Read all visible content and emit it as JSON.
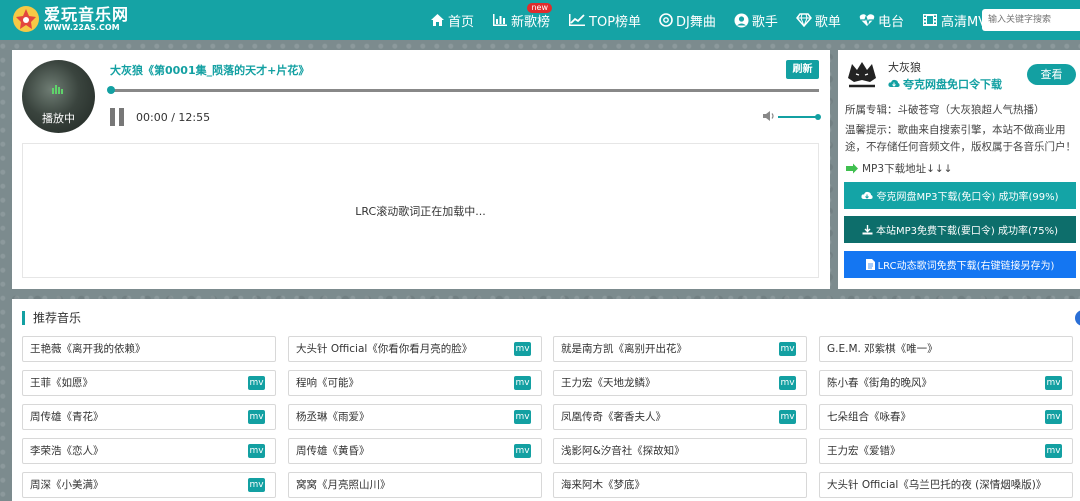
{
  "header": {
    "logo_title": "爱玩音乐网",
    "logo_url": "WWW.22AS.COM",
    "nav": [
      {
        "label": "首页",
        "icon": "home-icon"
      },
      {
        "label": "新歌榜",
        "icon": "bar-chart-icon",
        "badge": "new"
      },
      {
        "label": "TOP榜单",
        "icon": "line-chart-icon"
      },
      {
        "label": "DJ舞曲",
        "icon": "disc-icon"
      },
      {
        "label": "歌手",
        "icon": "user-icon"
      },
      {
        "label": "歌单",
        "icon": "diamond-icon"
      },
      {
        "label": "电台",
        "icon": "heartbeat-icon"
      },
      {
        "label": "高清MV",
        "icon": "film-icon"
      }
    ],
    "search_placeholder": "输入关键字搜索"
  },
  "player": {
    "cover_label": "播放中",
    "song_title": "大灰狼《第0001集_陨落的天才+片花》",
    "refresh_label": "刷新",
    "time": "00:00 / 12:55",
    "progress": 0,
    "volume": 1,
    "lrc_text": "LRC滚动歌词正在加载中..."
  },
  "side": {
    "artist_name": "大灰狼",
    "quark_link": "夸克网盘免口令下载",
    "view_label": "查看",
    "album": "所属专辑：斗破苍穹（大灰狼超人气热播）",
    "tip": "温馨提示：歌曲来自搜索引擎，本站不做商业用途，不存储任何音频文件，版权属于各音乐门户！",
    "mp3_label": "MP3下载地址↓↓↓",
    "download_buttons": [
      "夸克网盘MP3下载(免口令) 成功率(99%)",
      "本站MP3免费下载(要口令) 成功率(75%)",
      "LRC动态歌词免费下载(右键链接另存为)"
    ]
  },
  "recommend": {
    "title": "推荐音乐",
    "mv_label": "mv",
    "items": [
      {
        "text": "王艳薇《离开我的依赖》",
        "mv": false
      },
      {
        "text": "大头针 Official《你看你看月亮的脸》",
        "mv": true
      },
      {
        "text": "就是南方凯《离别开出花》",
        "mv": true
      },
      {
        "text": "G.E.M. 邓紫棋《唯一》",
        "mv": false
      },
      {
        "text": "王菲《如愿》",
        "mv": true
      },
      {
        "text": "程响《可能》",
        "mv": true
      },
      {
        "text": "王力宏《天地龙鳞》",
        "mv": true
      },
      {
        "text": "陈小春《街角的晚风》",
        "mv": true
      },
      {
        "text": "周传雄《青花》",
        "mv": true
      },
      {
        "text": "杨丞琳《雨爱》",
        "mv": true
      },
      {
        "text": "凤凰传奇《奢香夫人》",
        "mv": true
      },
      {
        "text": "七朵组合《咏春》",
        "mv": true
      },
      {
        "text": "李荣浩《恋人》",
        "mv": true
      },
      {
        "text": "周传雄《黄昏》",
        "mv": true
      },
      {
        "text": "浅影阿&汐音社《探故知》",
        "mv": false
      },
      {
        "text": "王力宏《爱错》",
        "mv": true
      },
      {
        "text": "周深《小美满》",
        "mv": true
      },
      {
        "text": "窝窝《月亮照山川》",
        "mv": false
      },
      {
        "text": "海来阿木《梦底》",
        "mv": false
      },
      {
        "text": "大头针 Official《乌兰巴托的夜 (深情烟嗓版)》",
        "mv": false
      }
    ]
  }
}
